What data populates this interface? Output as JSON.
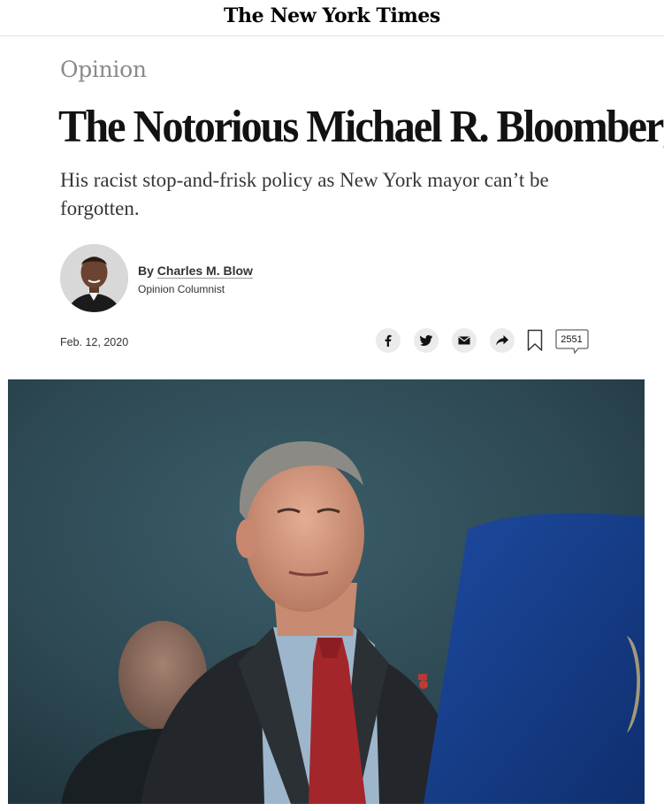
{
  "masthead": {
    "logo": "The New York Times"
  },
  "article": {
    "kicker": "Opinion",
    "headline": "The Notorious Michael R. Bloomberg",
    "dek": "His racist stop-and-frisk policy as New York mayor can’t be forgotten.",
    "byline_prefix": "By ",
    "author": "Charles M. Blow",
    "author_role": "Opinion Columnist",
    "date": "Feb. 12, 2020"
  },
  "toolbar": {
    "icons": [
      "facebook-icon",
      "twitter-icon",
      "email-icon",
      "share-icon",
      "bookmark-icon",
      "comments-icon"
    ],
    "comment_count": "2551"
  },
  "colors": {
    "headline": "#121212",
    "kicker": "#8a8a8a",
    "icon_bg": "#ebebeb",
    "hero_background": "#2e4b57"
  }
}
